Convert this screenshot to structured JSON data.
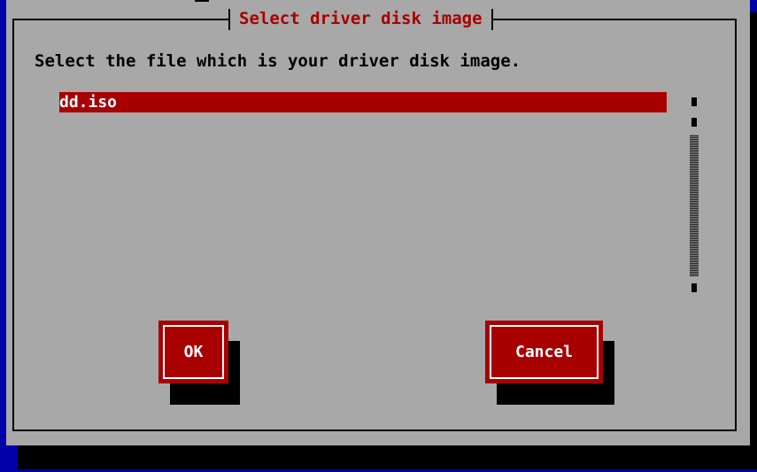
{
  "dialog": {
    "title": "Select driver disk image",
    "prompt": "Select the file which is your driver disk image."
  },
  "file_list": {
    "items": [
      "dd.iso"
    ],
    "selected_index": 0
  },
  "buttons": {
    "ok_label": "OK",
    "cancel_label": "Cancel"
  },
  "colors": {
    "screen_background": "#0000a8",
    "dialog_background": "#a8a8a8",
    "accent_red": "#a80000",
    "text_white": "#ffffff",
    "text_black": "#000000"
  }
}
